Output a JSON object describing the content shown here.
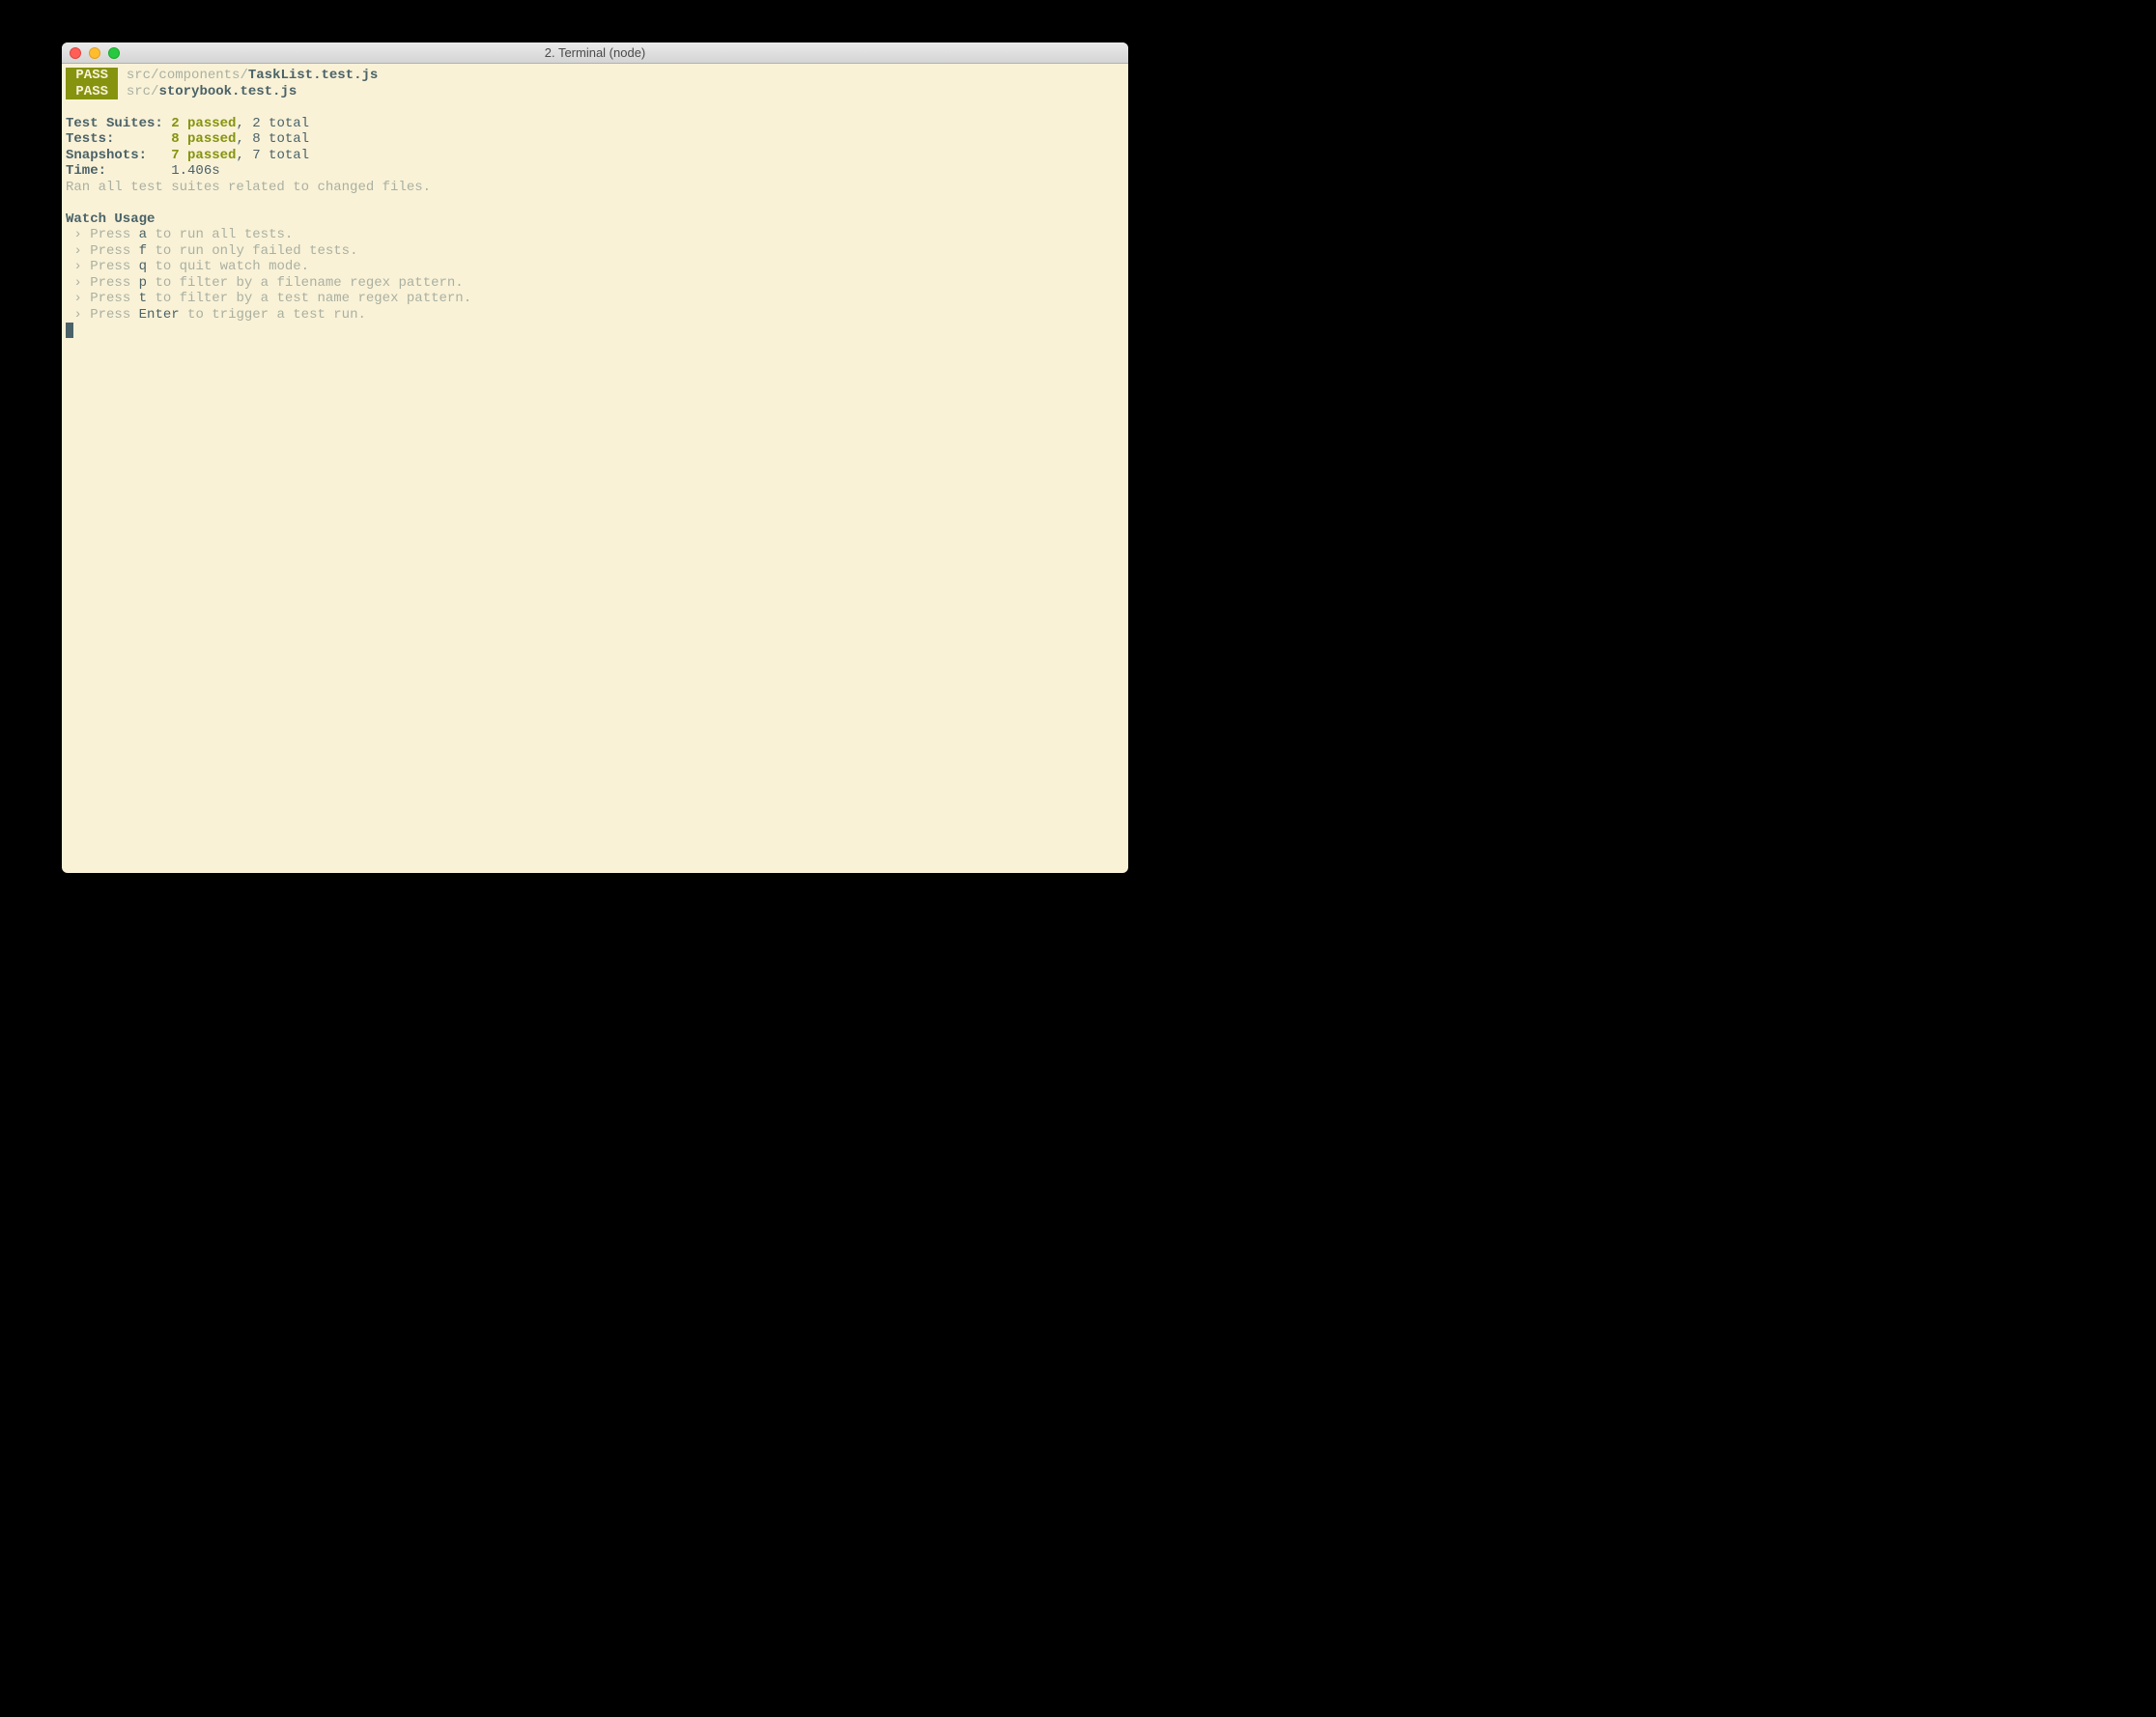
{
  "window": {
    "title": "2. Terminal (node)"
  },
  "pass_label": " PASS ",
  "files": [
    {
      "dir": "src/components/",
      "file": "TaskList.test.js"
    },
    {
      "dir": "src/",
      "file": "storybook.test.js"
    }
  ],
  "summary": {
    "suites_label": "Test Suites: ",
    "suites_passed": "2 passed",
    "suites_total": ", 2 total",
    "tests_label": "Tests:       ",
    "tests_passed": "8 passed",
    "tests_total": ", 8 total",
    "snapshots_label": "Snapshots:   ",
    "snapshots_passed": "7 passed",
    "snapshots_total": ", 7 total",
    "time_label": "Time:        ",
    "time_value": "1.406s",
    "ran_note": "Ran all test suites related to changed files."
  },
  "watch": {
    "heading": "Watch Usage",
    "arrow": " › ",
    "press": "Press ",
    "items": [
      {
        "key": "a",
        "desc": " to run all tests."
      },
      {
        "key": "f",
        "desc": " to run only failed tests."
      },
      {
        "key": "q",
        "desc": " to quit watch mode."
      },
      {
        "key": "p",
        "desc": " to filter by a filename regex pattern."
      },
      {
        "key": "t",
        "desc": " to filter by a test name regex pattern."
      },
      {
        "key": "Enter",
        "desc": " to trigger a test run."
      }
    ]
  }
}
